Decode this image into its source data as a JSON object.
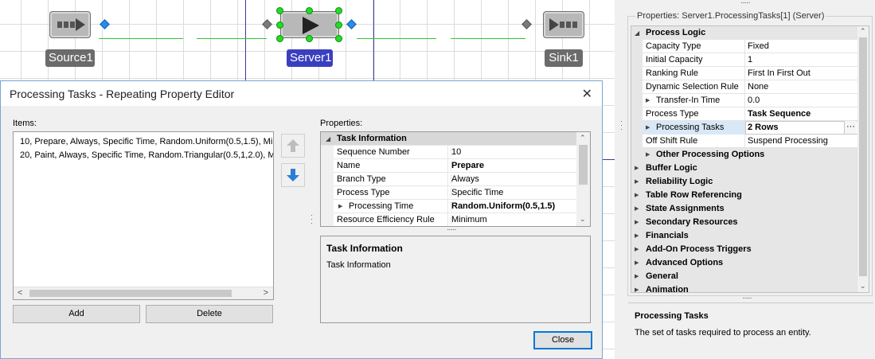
{
  "canvas": {
    "nodes": {
      "source": {
        "label": "Source1"
      },
      "server": {
        "label": "Server1"
      },
      "sink": {
        "label": "Sink1"
      }
    }
  },
  "dialog": {
    "title": "Processing Tasks - Repeating Property Editor",
    "items_label": "Items:",
    "items": [
      "10, Prepare, Always, Specific Time, Random.Uniform(0.5,1.5), Mir",
      "20, Paint, Always, Specific Time, Random.Triangular(0.5,1,2.0), M"
    ],
    "properties_label": "Properties:",
    "add_label": "Add",
    "delete_label": "Delete",
    "close_label": "Close",
    "grid": {
      "category": "Task Information",
      "rows": [
        {
          "key": "Sequence Number",
          "value": "10",
          "bold": false,
          "expandable": false
        },
        {
          "key": "Name",
          "value": "Prepare",
          "bold": true,
          "expandable": false
        },
        {
          "key": "Branch Type",
          "value": "Always",
          "bold": false,
          "expandable": false
        },
        {
          "key": "Process Type",
          "value": "Specific Time",
          "bold": false,
          "expandable": false
        },
        {
          "key": "Processing Time",
          "value": "Random.Uniform(0.5,1.5)",
          "bold": true,
          "expandable": true
        },
        {
          "key": "Resource Efficiency Rule",
          "value": "Minimum",
          "bold": false,
          "expandable": false
        }
      ]
    },
    "description": {
      "title": "Task Information",
      "text": "Task Information"
    }
  },
  "panel": {
    "title": "Properties: Server1.ProcessingTasks[1] (Server)",
    "process_logic": "Process Logic",
    "rows": [
      {
        "key": "Capacity Type",
        "value": "Fixed"
      },
      {
        "key": "Initial Capacity",
        "value": "1"
      },
      {
        "key": "Ranking Rule",
        "value": "First In First Out"
      },
      {
        "key": "Dynamic Selection Rule",
        "value": "None"
      },
      {
        "key": "Transfer-In Time",
        "value": "0.0"
      },
      {
        "key": "Process Type",
        "value": "Task Sequence"
      },
      {
        "key": "Processing Tasks",
        "value": "2 Rows"
      },
      {
        "key": "Off Shift Rule",
        "value": "Suspend Processing"
      }
    ],
    "other_options": "Other Processing Options",
    "categories": [
      "Buffer Logic",
      "Reliability Logic",
      "Table Row Referencing",
      "State Assignments",
      "Secondary Resources",
      "Financials",
      "Add-On Process Triggers",
      "Advanced Options",
      "General",
      "Animation"
    ],
    "description": {
      "title": "Processing Tasks",
      "text": "The set of tasks required to process an entity."
    },
    "ellipsis": "···"
  }
}
